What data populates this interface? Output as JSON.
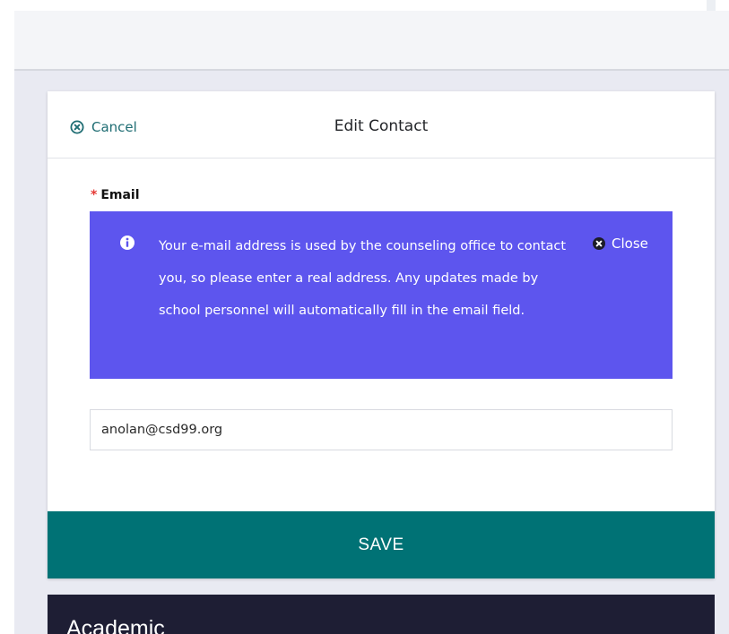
{
  "modal": {
    "title": "Edit Contact",
    "cancel_label": "Cancel"
  },
  "email_field": {
    "label": "Email",
    "required_marker": "*",
    "value": "anolan@csd99.org"
  },
  "info_box": {
    "text": "Your e-mail address is used by the counseling office to contact you, so please enter a real address. Any updates made by school personnel will automatically fill in the email field.",
    "close_label": "Close",
    "bg_color": "#5d55ee"
  },
  "save_button": {
    "label": "SAVE",
    "bg_color": "#007275"
  },
  "next_section": {
    "title": "Academic"
  },
  "icons": {
    "cancel": "circle-x-icon",
    "info": "info-icon",
    "close": "circle-x-icon"
  }
}
